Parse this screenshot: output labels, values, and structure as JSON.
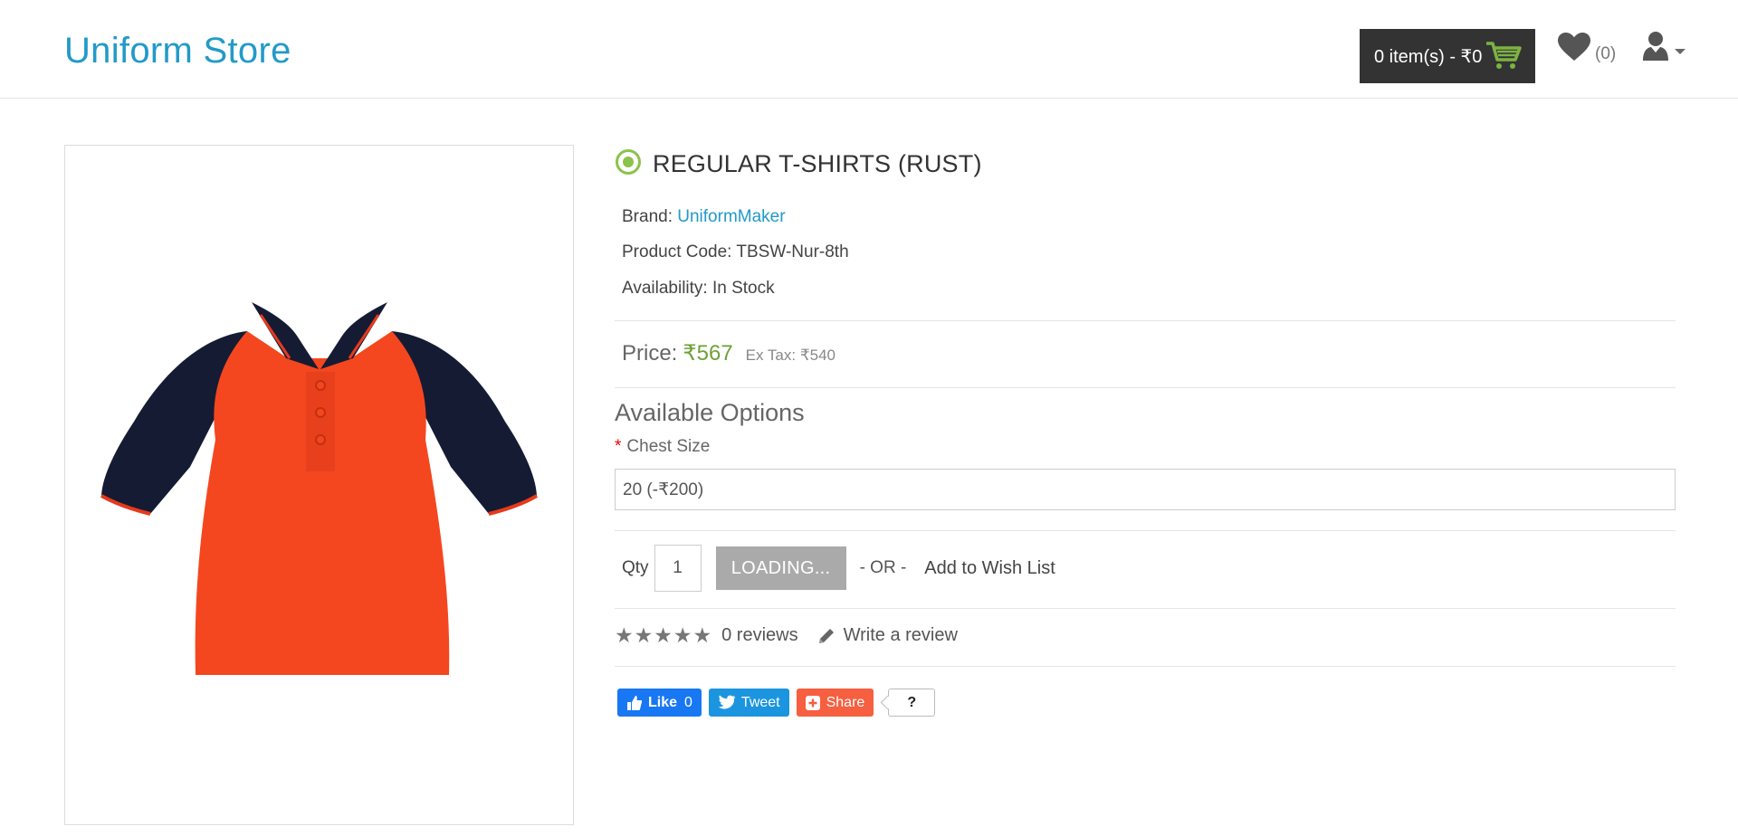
{
  "header": {
    "logo": "Uniform Store",
    "cart_label": "0 item(s) - ₹0",
    "wishlist_count": "(0)"
  },
  "product": {
    "title": "REGULAR T-SHIRTS (RUST)",
    "brand_label": "Brand:",
    "brand_name": "UniformMaker",
    "code_label": "Product Code:",
    "code_value": "TBSW-Nur-8th",
    "availability_label": "Availability:",
    "availability_value": "In Stock",
    "price_label": "Price:",
    "price_value": "₹567",
    "ex_tax": "Ex Tax: ₹540",
    "image_colors": {
      "body": "#f4471f",
      "sleeve": "#151b33",
      "trim": "#e63a1b"
    }
  },
  "options": {
    "title": "Available Options",
    "required_mark": "*",
    "chest_label": "Chest Size",
    "chest_selected": "20 (-₹200)"
  },
  "purchase": {
    "qty_label": "Qty",
    "qty_value": "1",
    "button_label": "LOADING...",
    "or_text": "- OR -",
    "wishlist_label": "Add to Wish List"
  },
  "reviews": {
    "rating": 0,
    "max_stars": 5,
    "count_text": "0 reviews",
    "write_label": "Write a review"
  },
  "share": {
    "like_label": "Like",
    "like_count": "0",
    "tweet_label": "Tweet",
    "share_label": "Share",
    "share_count": "?"
  },
  "colors": {
    "accent": "#229ac8",
    "price": "#6ea13a",
    "cart_bg": "#333333",
    "button_disabled": "#aaaaaa"
  }
}
